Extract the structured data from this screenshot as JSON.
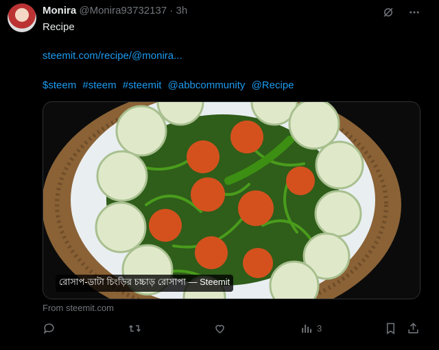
{
  "post": {
    "author_name": "Monira",
    "handle": "@Monira93732137",
    "separator": "·",
    "time": "3h",
    "text": "Recipe",
    "link": "steemit.com/recipe/@monira...",
    "hashtags": [
      "$steem",
      "#steem",
      "#steemit",
      "@abbcommunity",
      "@Recipe"
    ]
  },
  "card": {
    "caption": "রোসাপ-ডাটা চিংড়ির চচ্চাড় রোসাপা — Steemit",
    "source": "From steemit.com"
  },
  "actions": {
    "views_count": "3"
  },
  "icons": {
    "grok": "grok-icon",
    "more": "more-icon",
    "reply": "reply-icon",
    "repost": "repost-icon",
    "like": "like-icon",
    "views": "views-icon",
    "bookmark": "bookmark-icon",
    "share": "share-icon"
  },
  "colors": {
    "link": "#1d9bf0",
    "muted": "#71767b",
    "text": "#e7e9ea",
    "background": "#000000"
  }
}
